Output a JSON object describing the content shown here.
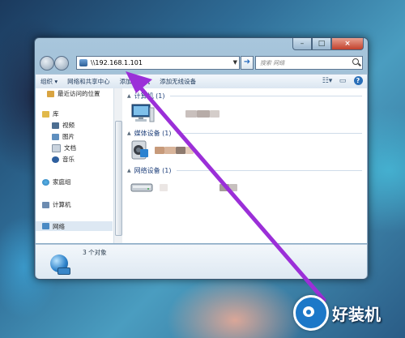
{
  "address_bar": {
    "path": "\\\\192.168.1.101"
  },
  "search": {
    "placeholder": "搜索 网络"
  },
  "toolbar": {
    "organize": "组织 ▾",
    "network_center": "网络和共享中心",
    "add_printer": "添加打印机",
    "add_wireless": "添加无线设备"
  },
  "nav": {
    "recent": "最近访问的位置",
    "library": "库",
    "video": "视频",
    "pictures": "图片",
    "documents": "文档",
    "music": "音乐",
    "homegroup": "家庭组",
    "computer": "计算机",
    "network": "网络"
  },
  "groups": {
    "computers": "计算机 (1)",
    "media": "媒体设备 (1)",
    "network_devices": "网络设备 (1)"
  },
  "status": {
    "text": "3 个对象"
  },
  "watermark": {
    "text": "好装机"
  },
  "colors": {
    "arrow": "#9b2fd8",
    "accent": "#1c78c8"
  }
}
